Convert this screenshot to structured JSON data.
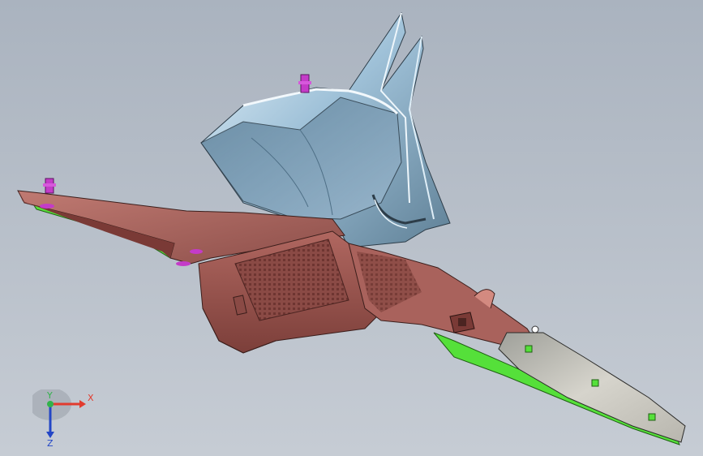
{
  "viewport": {
    "background_top": "#aab3bf",
    "background_bottom": "#c6ccd4"
  },
  "model": {
    "parts": [
      {
        "name": "air-duct-funnel",
        "color": "#a9c6db"
      },
      {
        "name": "bracket-panel",
        "color": "#b7706c"
      },
      {
        "name": "lower-housing",
        "color": "#a65f59"
      },
      {
        "name": "side-channel",
        "color": "#a9625c"
      },
      {
        "name": "green-seal-strip",
        "color": "#55e03a"
      },
      {
        "name": "end-plate",
        "color": "#c7c5bc"
      },
      {
        "name": "mounting-clip",
        "color": "#c43bc8"
      }
    ]
  },
  "triad": {
    "x_label": "X",
    "y_label": "Y",
    "z_label": "Z",
    "x_color": "#e23b2e",
    "y_color": "#31b24a",
    "z_color": "#2346c6"
  }
}
